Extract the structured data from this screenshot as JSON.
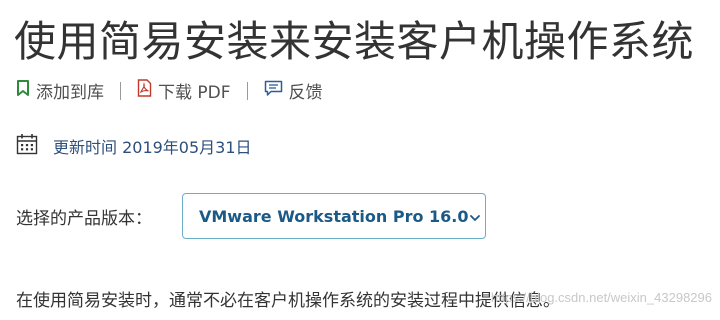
{
  "page": {
    "title": "使用简易安装来安装客户机操作系统"
  },
  "actions": [
    {
      "icon": "bookmark-icon",
      "label": "添加到库",
      "color": "#2f8a3e"
    },
    {
      "icon": "pdf-icon",
      "label": "下载 PDF",
      "color": "#c0392b"
    },
    {
      "icon": "feedback-icon",
      "label": "反馈",
      "color": "#2d5e9a"
    }
  ],
  "updated": {
    "icon": "calendar-icon",
    "text": "更新时间 2019年05月31日"
  },
  "version": {
    "label": "选择的产品版本：",
    "selected": "VMware Workstation Pro 16.0"
  },
  "content": {
    "paragraph": "在使用简易安装时，通常不必在客户机操作系统的安装过程中提供信息。"
  },
  "watermark": "https://blog.csdn.net/weixin_43298296"
}
